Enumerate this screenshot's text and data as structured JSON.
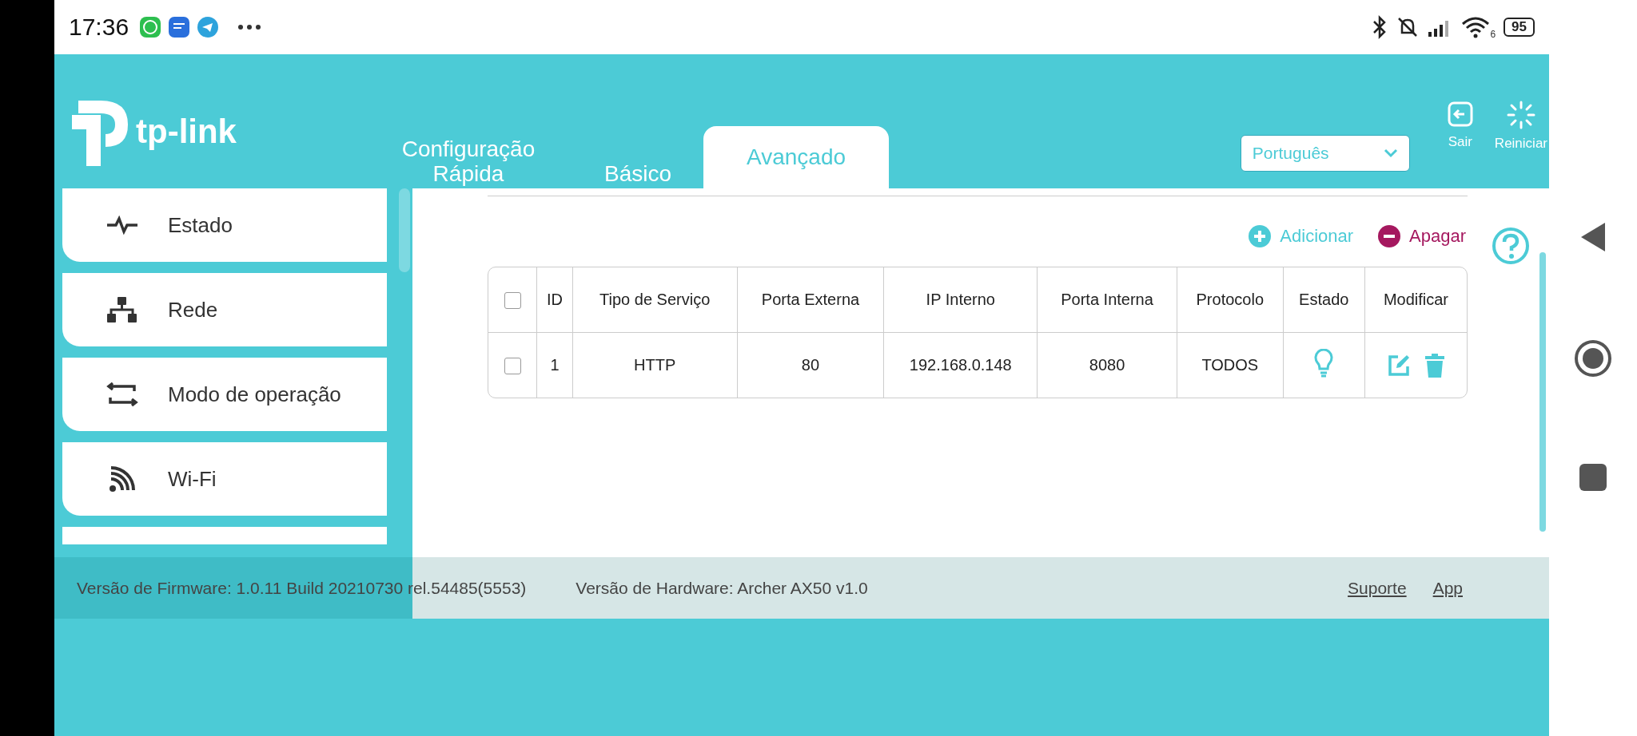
{
  "status_bar": {
    "time": "17:36",
    "wifi_label": "6",
    "battery": "95"
  },
  "header": {
    "logo_text": "tp-link",
    "tabs": [
      {
        "label": "Configuração Rápida",
        "selected": false
      },
      {
        "label": "Básico",
        "selected": false
      },
      {
        "label": "Avançado",
        "selected": true
      }
    ],
    "language": "Português",
    "actions": [
      {
        "kind": "logout",
        "label": "Sair"
      },
      {
        "kind": "reboot",
        "label": "Reiniciar"
      }
    ]
  },
  "sidebar": {
    "items": [
      {
        "kind": "pulse",
        "label": "Estado"
      },
      {
        "kind": "network",
        "label": "Rede"
      },
      {
        "kind": "mode",
        "label": "Modo de operação"
      },
      {
        "kind": "wifi",
        "label": "Wi-Fi"
      }
    ]
  },
  "toolbar": [
    {
      "kind": "add",
      "label": "Adicionar"
    },
    {
      "kind": "delete",
      "label": "Apagar"
    }
  ],
  "table": {
    "header_checked": false,
    "columns": [
      "ID",
      "Tipo de Serviço",
      "Porta Externa",
      "IP Interno",
      "Porta Interna",
      "Protocolo",
      "Estado",
      "Modificar"
    ],
    "rows": [
      {
        "checked": false,
        "cells": [
          "1",
          "HTTP",
          "80",
          "192.168.0.148",
          "8080",
          "TODOS"
        ],
        "status_on": true
      }
    ]
  },
  "footer": {
    "firmware": "Versão de Firmware: 1.0.11 Build 20210730 rel.54485(5553)",
    "hardware": "Versão de Hardware: Archer AX50 v1.0",
    "links": [
      "Suporte",
      "App"
    ]
  }
}
